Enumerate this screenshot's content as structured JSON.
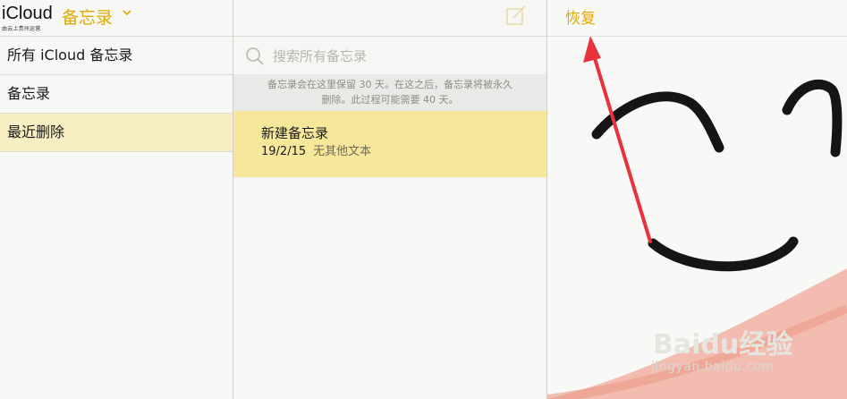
{
  "header": {
    "brand": "iCloud",
    "brand_sub": "由云上贵州运营",
    "app_title": "备忘录"
  },
  "sidebar": {
    "folders": [
      {
        "label": "所有 iCloud 备忘录"
      },
      {
        "label": "备忘录"
      },
      {
        "label": "最近删除",
        "selected": true
      }
    ]
  },
  "notes_list": {
    "search": {
      "placeholder": "搜索所有备忘录"
    },
    "info_banner": {
      "line1": "备忘录会在这里保留 30 天。在这之后，备忘录将被永久",
      "line2": "删除。此过程可能需要 40 天。"
    },
    "items": [
      {
        "title": "新建备忘录",
        "date": "19/2/15",
        "preview": "无其他文本"
      }
    ]
  },
  "detail": {
    "restore_label": "恢复"
  },
  "watermark": {
    "logo": "Baidu经验",
    "url": "jingyan.baidu.com"
  },
  "colors": {
    "accent": "#e0a800",
    "selected_folder": "#f8eec3",
    "selected_note": "#f6e79a",
    "arrow": "#e8323c"
  },
  "icons": {
    "compose": "compose-icon",
    "search": "search-icon",
    "chevron": "chevron-down-icon"
  }
}
